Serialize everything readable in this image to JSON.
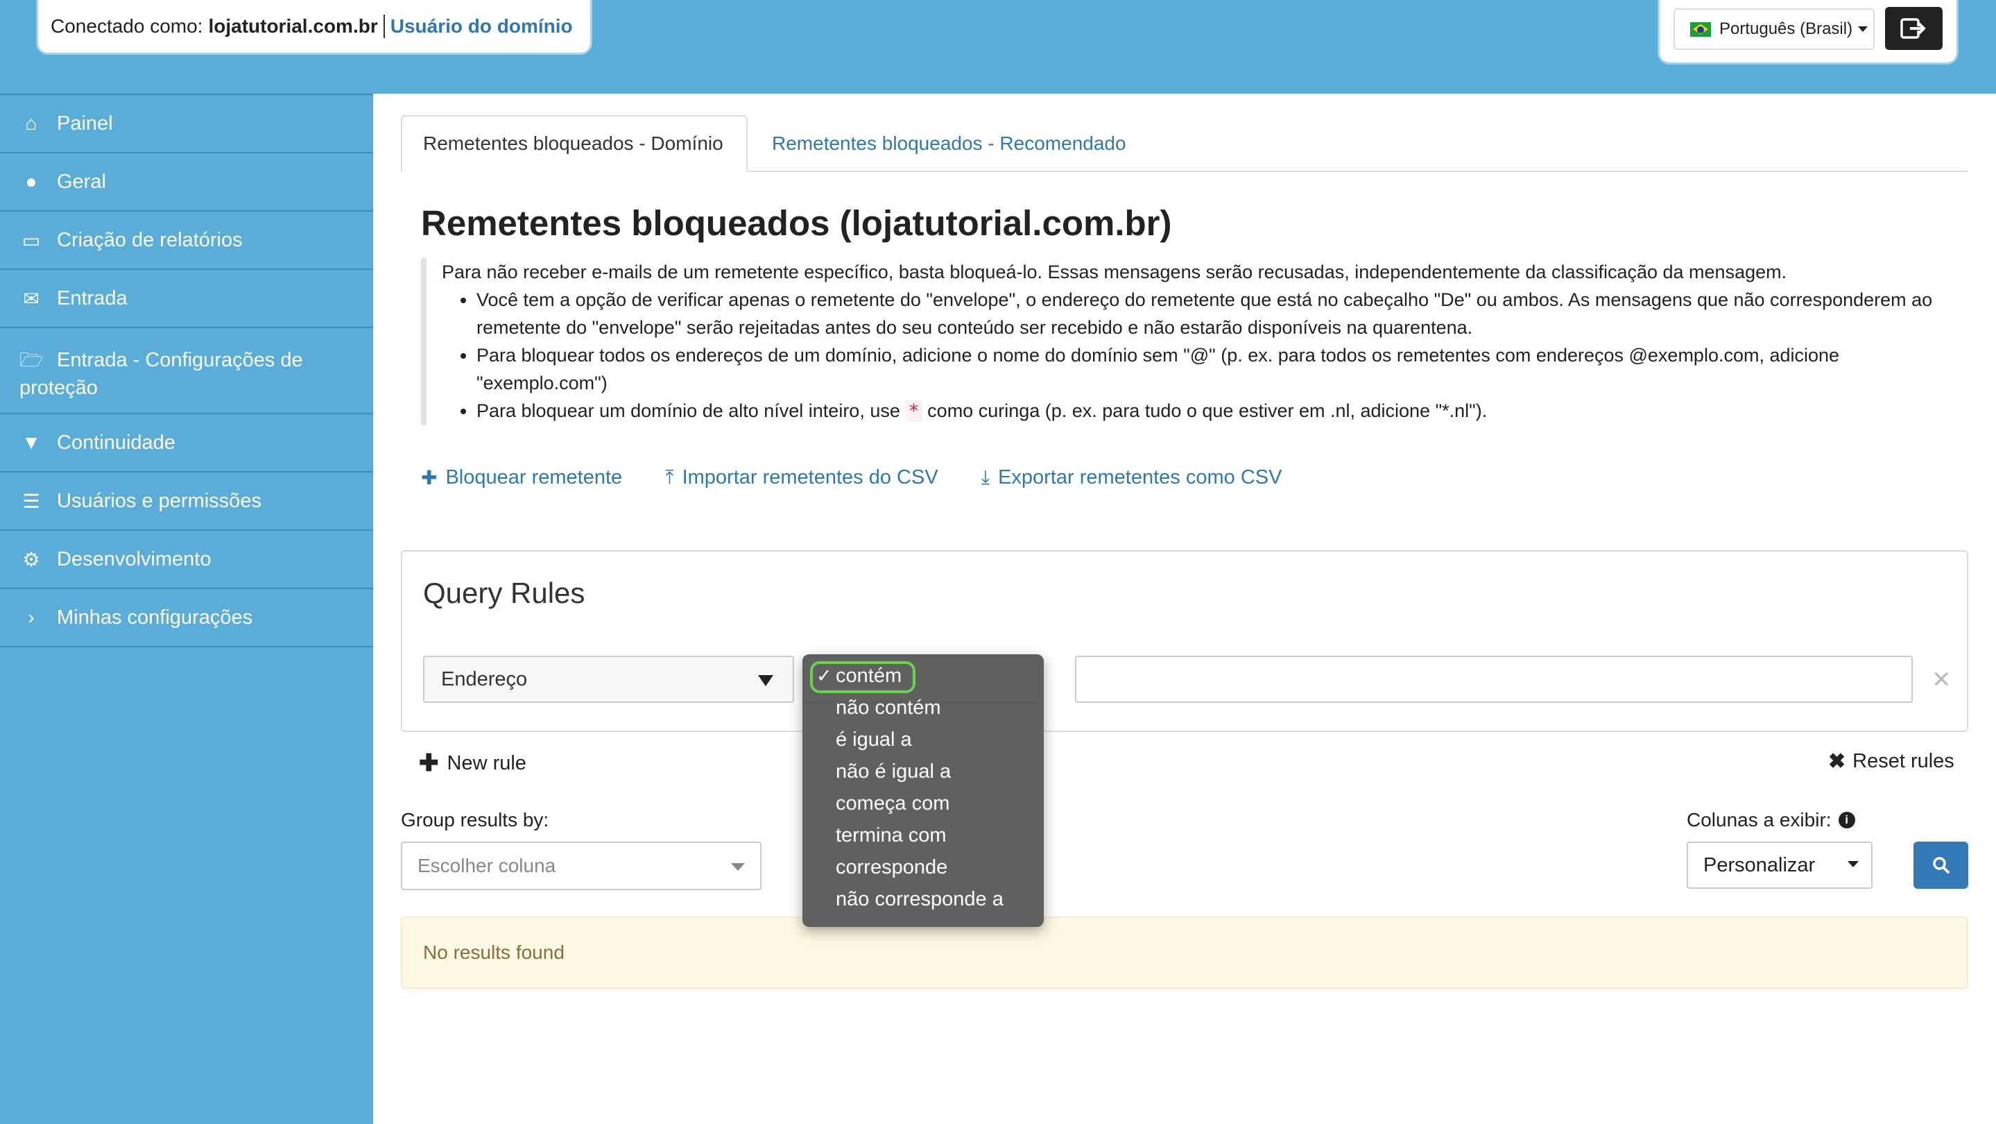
{
  "header": {
    "connected_prefix": "Conectado como:",
    "domain": "lojatutorial.com.br",
    "role_link": "Usuário do domínio",
    "language": "Português (Brasil)"
  },
  "sidebar": {
    "items": [
      {
        "label": "Painel",
        "icon": "home-icon"
      },
      {
        "label": "Geral",
        "icon": "globe-icon"
      },
      {
        "label": "Criação de relatórios",
        "icon": "inbox-icon"
      },
      {
        "label": "Entrada",
        "icon": "envelope-icon"
      },
      {
        "label": "Entrada - Configurações de proteção",
        "icon": "folder-open-icon"
      },
      {
        "label": "Continuidade",
        "icon": "filter-icon"
      },
      {
        "label": "Usuários e permissões",
        "icon": "list-icon"
      },
      {
        "label": "Desenvolvimento",
        "icon": "gear-icon"
      },
      {
        "label": "Minhas configurações",
        "icon": "chevron-right-icon"
      }
    ]
  },
  "tabs": {
    "active": "Remetentes bloqueados - Domínio",
    "other": "Remetentes bloqueados - Recomendado"
  },
  "page": {
    "title": "Remetentes bloqueados (lojatutorial.com.br)",
    "intro": "Para não receber e-mails de um remetente específico, basta bloqueá-lo. Essas mensagens serão recusadas, independentemente da classificação da mensagem.",
    "bullet1": "Você tem a opção de verificar apenas o remetente do \"envelope\", o endereço do remetente que está no cabeçalho \"De\" ou ambos. As mensagens que não corresponderem ao remetente do \"envelope\" serão rejeitadas antes do seu conteúdo ser recebido e não estarão disponíveis na quarentena.",
    "bullet2": "Para bloquear todos os endereços de um domínio, adicione o nome do domínio sem \"@\" (p. ex. para todos os remetentes com endereços @exemplo.com, adicione \"exemplo.com\")",
    "bullet3_pre": "Para bloquear um domínio de alto nível inteiro, use",
    "bullet3_code": "*",
    "bullet3_post": "como curinga (p. ex. para tudo o que estiver em .nl, adicione \"*.nl\")."
  },
  "actions": {
    "block": "Bloquear remetente",
    "import": "Importar remetentes do CSV",
    "export": "Exportar remetentes como CSV"
  },
  "query": {
    "title": "Query Rules",
    "field": "Endereço",
    "value": "",
    "new_rule": "New rule",
    "reset_rules": "Reset rules"
  },
  "operators": {
    "selected": "contém",
    "options": [
      "contém",
      "não contém",
      "é igual a",
      "não é igual a",
      "começa com",
      "termina com",
      "corresponde",
      "não corresponde a"
    ]
  },
  "group": {
    "label": "Group results by:",
    "placeholder": "Escolher coluna"
  },
  "columns": {
    "label": "Colunas a exibir:",
    "value": "Personalizar"
  },
  "results": {
    "message": "No results found"
  },
  "colors": {
    "brand": "#5aacd9",
    "link": "#2f77b3",
    "primary_button": "#337ab7",
    "selection_highlight": "#6bd24b"
  }
}
